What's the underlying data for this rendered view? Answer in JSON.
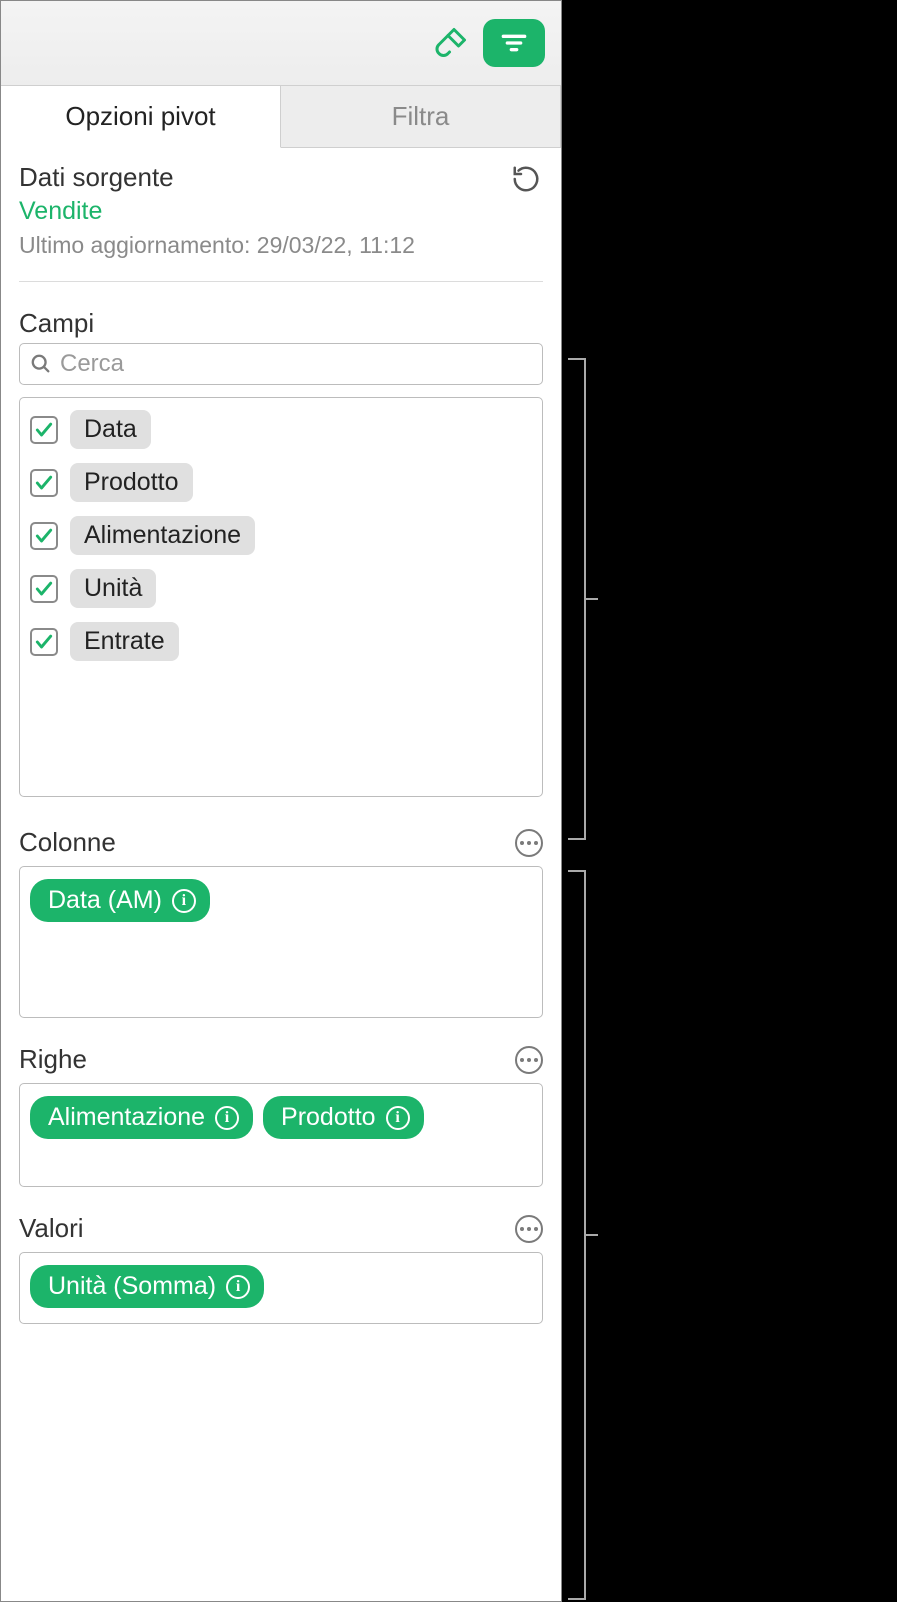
{
  "tabs": {
    "pivot": "Opzioni pivot",
    "filter": "Filtra"
  },
  "source": {
    "title": "Dati sorgente",
    "link": "Vendite",
    "last_update": "Ultimo aggiornamento: 29/03/22, 11:12"
  },
  "fields": {
    "title": "Campi",
    "search_placeholder": "Cerca",
    "items": [
      {
        "label": "Data",
        "checked": true
      },
      {
        "label": "Prodotto",
        "checked": true
      },
      {
        "label": "Alimentazione",
        "checked": true
      },
      {
        "label": "Unità",
        "checked": true
      },
      {
        "label": "Entrate",
        "checked": true
      }
    ]
  },
  "columns": {
    "title": "Colonne",
    "items": [
      {
        "label": "Data (AM)"
      }
    ]
  },
  "rows": {
    "title": "Righe",
    "items": [
      {
        "label": "Alimentazione"
      },
      {
        "label": "Prodotto"
      }
    ]
  },
  "values": {
    "title": "Valori",
    "items": [
      {
        "label": "Unità (Somma)"
      }
    ]
  }
}
